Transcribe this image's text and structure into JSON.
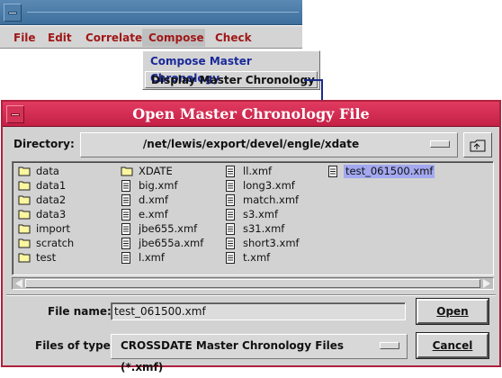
{
  "menubar": {
    "items": [
      {
        "label": "File"
      },
      {
        "label": "Edit"
      },
      {
        "label": "Correlate"
      },
      {
        "label": "Compose"
      },
      {
        "label": "Check"
      }
    ],
    "active": "Compose"
  },
  "compose_menu": {
    "items": [
      {
        "label": "Compose Master Chronology"
      },
      {
        "label": "Display Master Chronology"
      }
    ]
  },
  "dialog": {
    "title": "Open Master Chronology File",
    "directory_label": "Directory:",
    "directory_value": "/net/lewis/export/devel/engle/xdate",
    "files": [
      {
        "name": "data",
        "icon": "folder-icon"
      },
      {
        "name": "data1",
        "icon": "folder-icon"
      },
      {
        "name": "data2",
        "icon": "folder-icon"
      },
      {
        "name": "data3",
        "icon": "folder-icon"
      },
      {
        "name": "import",
        "icon": "folder-icon"
      },
      {
        "name": "scratch",
        "icon": "folder-icon"
      },
      {
        "name": "test",
        "icon": "folder-icon"
      },
      {
        "name": "XDATE",
        "icon": "folder-icon"
      },
      {
        "name": "big.xmf",
        "icon": "file-icon"
      },
      {
        "name": "d.xmf",
        "icon": "file-icon"
      },
      {
        "name": "e.xmf",
        "icon": "file-icon"
      },
      {
        "name": "jbe655.xmf",
        "icon": "file-icon"
      },
      {
        "name": "jbe655a.xmf",
        "icon": "file-icon"
      },
      {
        "name": "l.xmf",
        "icon": "file-icon"
      },
      {
        "name": "ll.xmf",
        "icon": "file-icon"
      },
      {
        "name": "long3.xmf",
        "icon": "file-icon"
      },
      {
        "name": "match.xmf",
        "icon": "file-icon"
      },
      {
        "name": "s3.xmf",
        "icon": "file-icon"
      },
      {
        "name": "s31.xmf",
        "icon": "file-icon"
      },
      {
        "name": "short3.xmf",
        "icon": "file-icon"
      },
      {
        "name": "t.xmf",
        "icon": "file-icon"
      },
      {
        "name": "test_061500.xmf",
        "icon": "file-icon",
        "selected": true
      }
    ],
    "file_name_label": "File name:",
    "file_name_value": "test_061500.xmf",
    "files_of_type_label": "Files of type:",
    "files_of_type_value": "CROSSDATE Master Chronology Files (*.xmf)",
    "open_label": "Open",
    "cancel_label": "Cancel"
  },
  "colors": {
    "dialog_title_bg": "#d3294f",
    "menu_text": "#a01818",
    "selection": "#a3a8ef",
    "main_titlebar": "#4a7aa6"
  }
}
